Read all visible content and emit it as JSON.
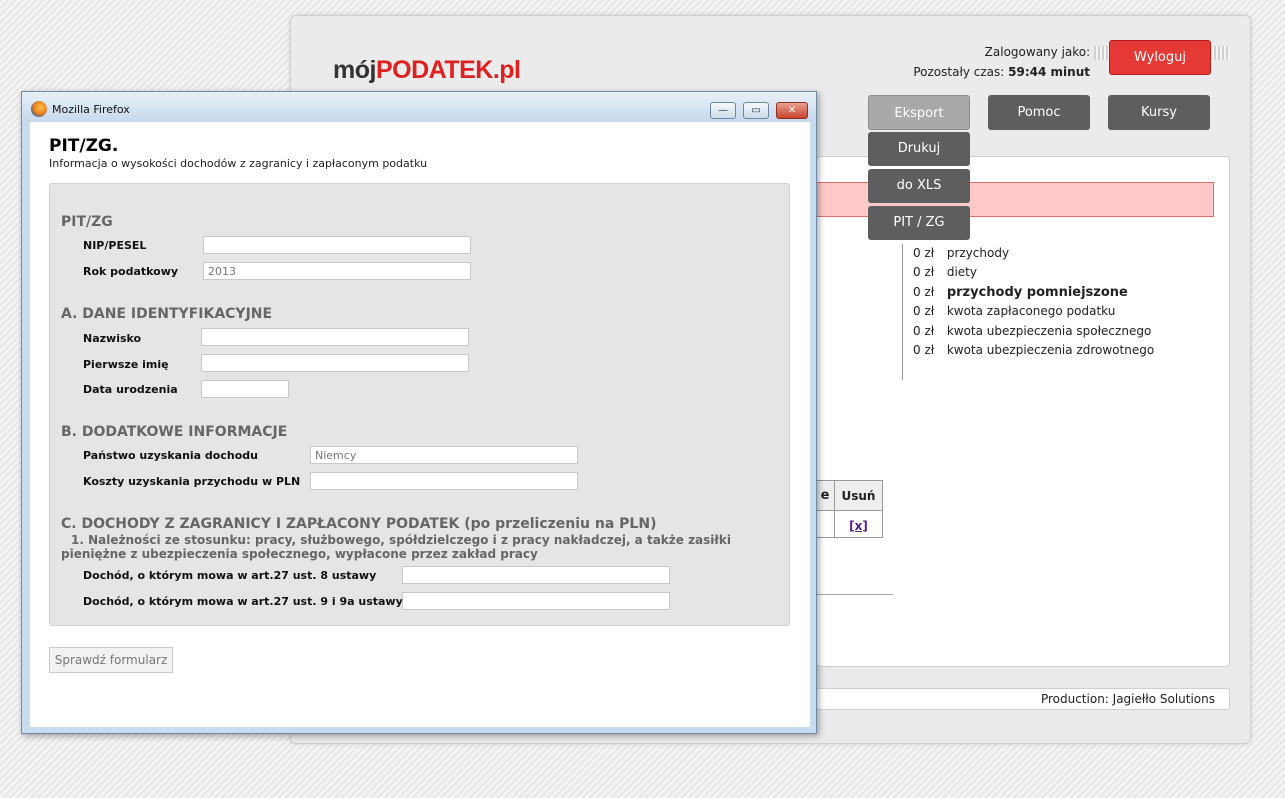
{
  "app": {
    "logo_part1": "mój",
    "logo_part2": "PODATEK.pl",
    "logged_in_label": "Zalogowany jako:",
    "time_label": "Pozostały czas:",
    "time_value": "59:44 minut",
    "logout_label": "Wyloguj",
    "nav": {
      "export_label": "Eksport",
      "help_label": "Pomoc",
      "courses_label": "Kursy"
    },
    "export_menu": [
      "Drukuj",
      "do XLS",
      "PIT / ZG"
    ],
    "summary": [
      {
        "amount": "0 zł",
        "label": "przychody",
        "bold": false
      },
      {
        "amount": "0 zł",
        "label": "diety",
        "bold": false
      },
      {
        "amount": "0 zł",
        "label": "przychody pomniejszone",
        "bold": true
      },
      {
        "amount": "0 zł",
        "label": "kwota zapłaconego podatku",
        "bold": false
      },
      {
        "amount": "0 zł",
        "label": "kwota ubezpieczenia społecznego",
        "bold": false
      },
      {
        "amount": "0 zł",
        "label": "kwota ubezpieczenia zdrowotnego",
        "bold": false
      }
    ],
    "table": {
      "partial_header": "e",
      "delete_header": "Usuń",
      "delete_link": "[x]"
    },
    "footer": "Production: Jagiełło Solutions"
  },
  "popup": {
    "window_title": "Mozilla Firefox",
    "win_buttons": {
      "minimize": "—",
      "maximize": "▭",
      "close": "✕"
    },
    "title": "PIT/ZG.",
    "subtitle": "Informacja o wysokości dochodów z zagranicy i zapłaconym podatku",
    "sections": {
      "pit": "PIT/ZG",
      "a": "A. DANE IDENTYFIKACYJNE",
      "b": "B. DODATKOWE INFORMACJE",
      "c": "C. DOCHODY Z ZAGRANICY I ZAPŁACONY PODATEK (po przeliczeniu na PLN)"
    },
    "fields": {
      "nip_label": "NIP/PESEL",
      "nip_value": "",
      "year_label": "Rok podatkowy",
      "year_value": "2013",
      "surname_label": "Nazwisko",
      "surname_value": "",
      "first_name_label": "Pierwsze imię",
      "first_name_value": "",
      "birth_label": "Data urodzenia",
      "birth_value": "",
      "country_label": "Państwo uzyskania dochodu",
      "country_value": "Niemcy",
      "costs_label": "Koszty uzyskania przychodu w PLN",
      "costs_value": "",
      "income8_label": "Dochód, o którym mowa w art.27 ust. 8 ustawy",
      "income8_value": "",
      "income9_label": "Dochód, o którym mowa w art.27 ust. 9 i 9a ustawy",
      "income9_value": ""
    },
    "note_c1": "1. Należności ze stosunku: pracy, służbowego, spółdzielczego i z pracy nakładczej, a także zasiłki pieniężne z ubezpieczenia społecznego, wypłacone przez zakład pracy",
    "check_button": "Sprawdź formularz"
  }
}
